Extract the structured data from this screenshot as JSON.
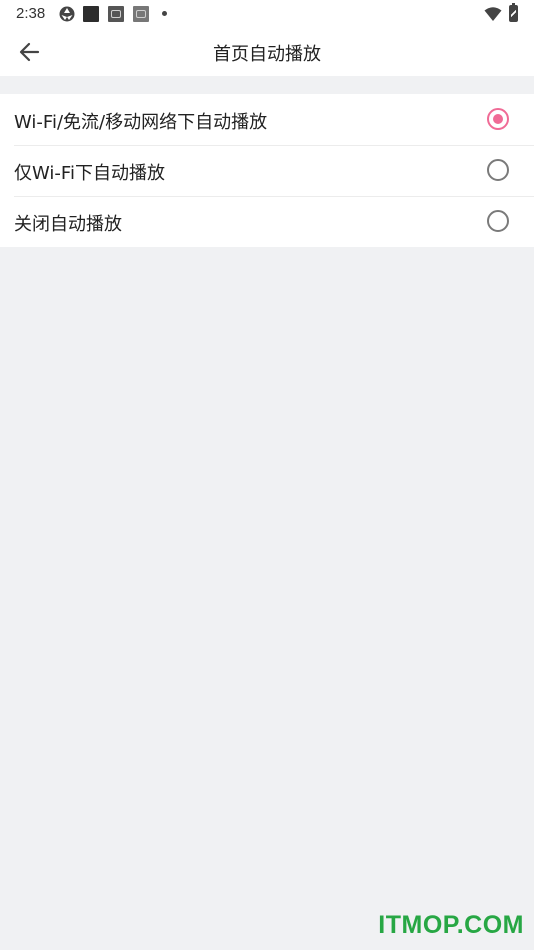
{
  "status_bar": {
    "time": "2:38",
    "icons": [
      "aperture-icon",
      "notification-app-icon",
      "notification-app-icon",
      "notification-app-icon",
      "more-notifications-dot",
      "wifi-icon",
      "battery-charging-icon"
    ]
  },
  "app_bar": {
    "back_icon": "arrow-left-icon",
    "title": "首页自动播放"
  },
  "options": [
    {
      "label": "Wi-Fi/免流/移动网络下自动播放",
      "selected": true
    },
    {
      "label": "仅Wi-Fi下自动播放",
      "selected": false
    },
    {
      "label": "关闭自动播放",
      "selected": false
    }
  ],
  "colors": {
    "accent": "#f06b96",
    "background": "#f0f1f3",
    "surface": "#ffffff",
    "watermark": "#27a744"
  },
  "watermark": "ITMOP.COM"
}
